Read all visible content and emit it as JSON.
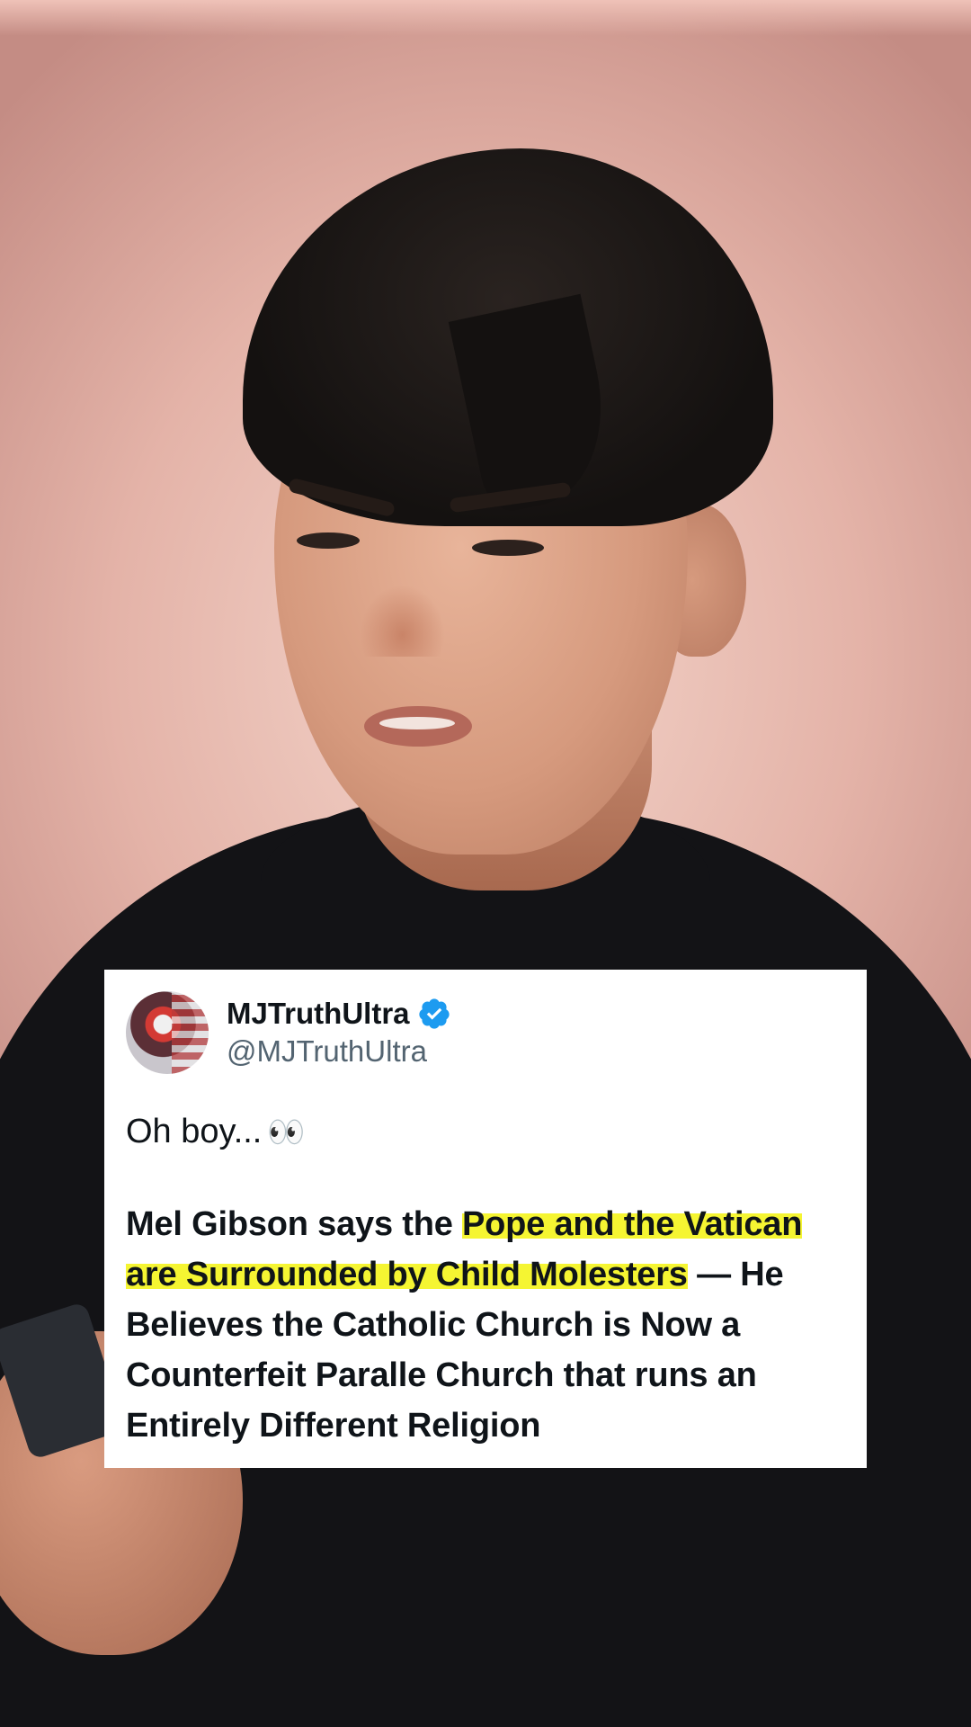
{
  "tweet": {
    "display_name": "MJTruthUltra",
    "handle": "@MJTruthUltra",
    "verified": true,
    "intro": "Oh boy...",
    "intro_emoji": "👀",
    "body_before": "Mel Gibson says the ",
    "body_highlight": "Pope and the Vatican are Surrounded by Child Molesters",
    "body_after": " — He Believes the Catholic Church is Now a Counterfeit Paralle Church that runs an Entirely Different Religion",
    "highlight_color": "#f5f532"
  },
  "colors": {
    "background": "#e4b3a8",
    "shirt": "#131316",
    "verified_badge": "#1d9bf0",
    "handle_text": "#536471"
  }
}
